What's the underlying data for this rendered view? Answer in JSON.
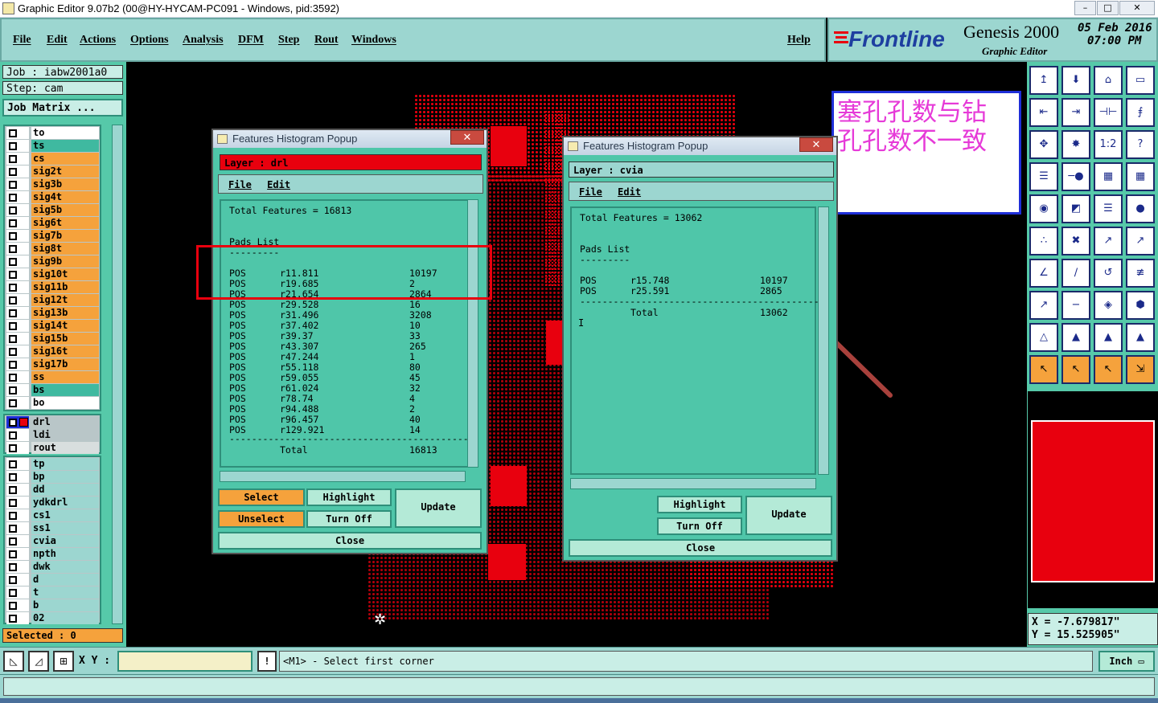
{
  "window": {
    "title": "Graphic Editor 9.07b2 (00@HY-HYCAM-PC091 - Windows, pid:3592)",
    "minimize": "–",
    "maximize": "□",
    "close": "✕"
  },
  "menu": [
    "File",
    "Edit",
    "Actions",
    "Options",
    "Analysis",
    "DFM",
    "Step",
    "Rout",
    "Windows"
  ],
  "help": "Help",
  "brand": {
    "logo": "Frontline",
    "product": "Genesis 2000",
    "subtitle": "Graphic Editor",
    "date": "05 Feb 2016",
    "time": "07:00 PM"
  },
  "job": {
    "job_label": "Job : iabw2001a0",
    "step_label": "Step: cam",
    "matrix_button": "Job Matrix ..."
  },
  "layers_group1": [
    {
      "name": "to",
      "color": "#ffffff"
    },
    {
      "name": "ts",
      "color": "#3fb9a0"
    },
    {
      "name": "cs",
      "color": "#f5a23c"
    },
    {
      "name": "sig2t",
      "color": "#f5a23c"
    },
    {
      "name": "sig3b",
      "color": "#f5a23c"
    },
    {
      "name": "sig4t",
      "color": "#f5a23c"
    },
    {
      "name": "sig5b",
      "color": "#f5a23c"
    },
    {
      "name": "sig6t",
      "color": "#f5a23c"
    },
    {
      "name": "sig7b",
      "color": "#f5a23c"
    },
    {
      "name": "sig8t",
      "color": "#f5a23c"
    },
    {
      "name": "sig9b",
      "color": "#f5a23c"
    },
    {
      "name": "sig10t",
      "color": "#f5a23c"
    },
    {
      "name": "sig11b",
      "color": "#f5a23c"
    },
    {
      "name": "sig12t",
      "color": "#f5a23c"
    },
    {
      "name": "sig13b",
      "color": "#f5a23c"
    },
    {
      "name": "sig14t",
      "color": "#f5a23c"
    },
    {
      "name": "sig15b",
      "color": "#f5a23c"
    },
    {
      "name": "sig16t",
      "color": "#f5a23c"
    },
    {
      "name": "sig17b",
      "color": "#f5a23c"
    },
    {
      "name": "ss",
      "color": "#f5a23c"
    },
    {
      "name": "bs",
      "color": "#3fb9a0"
    },
    {
      "name": "bo",
      "color": "#ffffff"
    }
  ],
  "layers_group2": [
    {
      "name": "drl",
      "color": "#b9c6c8"
    },
    {
      "name": "ldi",
      "color": "#b9c6c8"
    },
    {
      "name": "rout",
      "color": "#d8dede"
    }
  ],
  "layers_group3": [
    {
      "name": "tp"
    },
    {
      "name": "bp"
    },
    {
      "name": "dd"
    },
    {
      "name": "ydkdrl"
    },
    {
      "name": "cs1"
    },
    {
      "name": "ss1"
    },
    {
      "name": "cvia"
    },
    {
      "name": "npth"
    },
    {
      "name": "dwk"
    },
    {
      "name": "d"
    },
    {
      "name": "t"
    },
    {
      "name": "b"
    },
    {
      "name": "02"
    }
  ],
  "selected": "Selected : 0",
  "popup1": {
    "title": "Features Histogram Popup",
    "close": "✕",
    "layer": "Layer :  drl",
    "menu_file": "File",
    "menu_edit": "Edit",
    "total_features": "Total Features = 16813",
    "pads_list": "Pads List",
    "underline": "---------",
    "rows": [
      {
        "type": "POS",
        "sym": "r11.811",
        "count": "10197"
      },
      {
        "type": "POS",
        "sym": "r19.685",
        "count": "2"
      },
      {
        "type": "POS",
        "sym": "r21.654",
        "count": "2864"
      },
      {
        "type": "POS",
        "sym": "r29.528",
        "count": "16"
      },
      {
        "type": "POS",
        "sym": "r31.496",
        "count": "3208"
      },
      {
        "type": "POS",
        "sym": "r37.402",
        "count": "10"
      },
      {
        "type": "POS",
        "sym": "r39.37",
        "count": "33"
      },
      {
        "type": "POS",
        "sym": "r43.307",
        "count": "265"
      },
      {
        "type": "POS",
        "sym": "r47.244",
        "count": "1"
      },
      {
        "type": "POS",
        "sym": "r55.118",
        "count": "80"
      },
      {
        "type": "POS",
        "sym": "r59.055",
        "count": "45"
      },
      {
        "type": "POS",
        "sym": "r61.024",
        "count": "32"
      },
      {
        "type": "POS",
        "sym": "r78.74",
        "count": "4"
      },
      {
        "type": "POS",
        "sym": "r94.488",
        "count": "2"
      },
      {
        "type": "POS",
        "sym": "r96.457",
        "count": "40"
      },
      {
        "type": "POS",
        "sym": "r129.921",
        "count": "14"
      }
    ],
    "separator": "--------------------------------------------",
    "total_label": "Total",
    "total_value": "16813",
    "btn_select": "Select",
    "btn_unselect": "Unselect",
    "btn_highlight": "Highlight",
    "btn_turnoff": "Turn Off",
    "btn_update": "Update",
    "btn_close": "Close"
  },
  "popup2": {
    "title": "Features Histogram Popup",
    "close": "✕",
    "layer": "Layer :  cvia",
    "menu_file": "File",
    "menu_edit": "Edit",
    "total_features": "Total Features = 13062",
    "pads_list": "Pads List",
    "underline": "---------",
    "rows": [
      {
        "type": "POS",
        "sym": "r15.748",
        "count": "10197"
      },
      {
        "type": "POS",
        "sym": "r25.591",
        "count": "2865"
      }
    ],
    "separator": "--------------------------------------------",
    "total_label": "Total",
    "total_value": "13062",
    "btn_highlight": "Highlight",
    "btn_turnoff": "Turn Off",
    "btn_update": "Update",
    "btn_close": "Close"
  },
  "annotation": {
    "line1": "塞孔孔数与钻",
    "line2": "孔孔数不一致",
    "color": "#e63ad8"
  },
  "tools": [
    "↥",
    "⬇",
    "⌂",
    "▭",
    "⇤",
    "⇥",
    "⊣⊢",
    "⨎",
    "✥",
    "✸",
    "1:2",
    "?",
    "☰",
    "─●",
    "▦",
    "▦",
    "◉",
    "◩",
    "☰",
    "●",
    "∴",
    "✖",
    "↗",
    "↗",
    "∠",
    "∕",
    "↺",
    "≢",
    "↗",
    "−",
    "◈",
    "⬢",
    "△",
    "▲",
    "▲",
    "▲",
    "↖",
    "↖",
    "↖",
    "⇲"
  ],
  "coords": {
    "x": "X = -7.679817\"",
    "y": "Y = 15.525905\""
  },
  "status": {
    "xy_label": "X Y :",
    "xy_value": "",
    "prompt": "<M1> - Select first corner",
    "unit": "Inch",
    "alert": "!"
  }
}
